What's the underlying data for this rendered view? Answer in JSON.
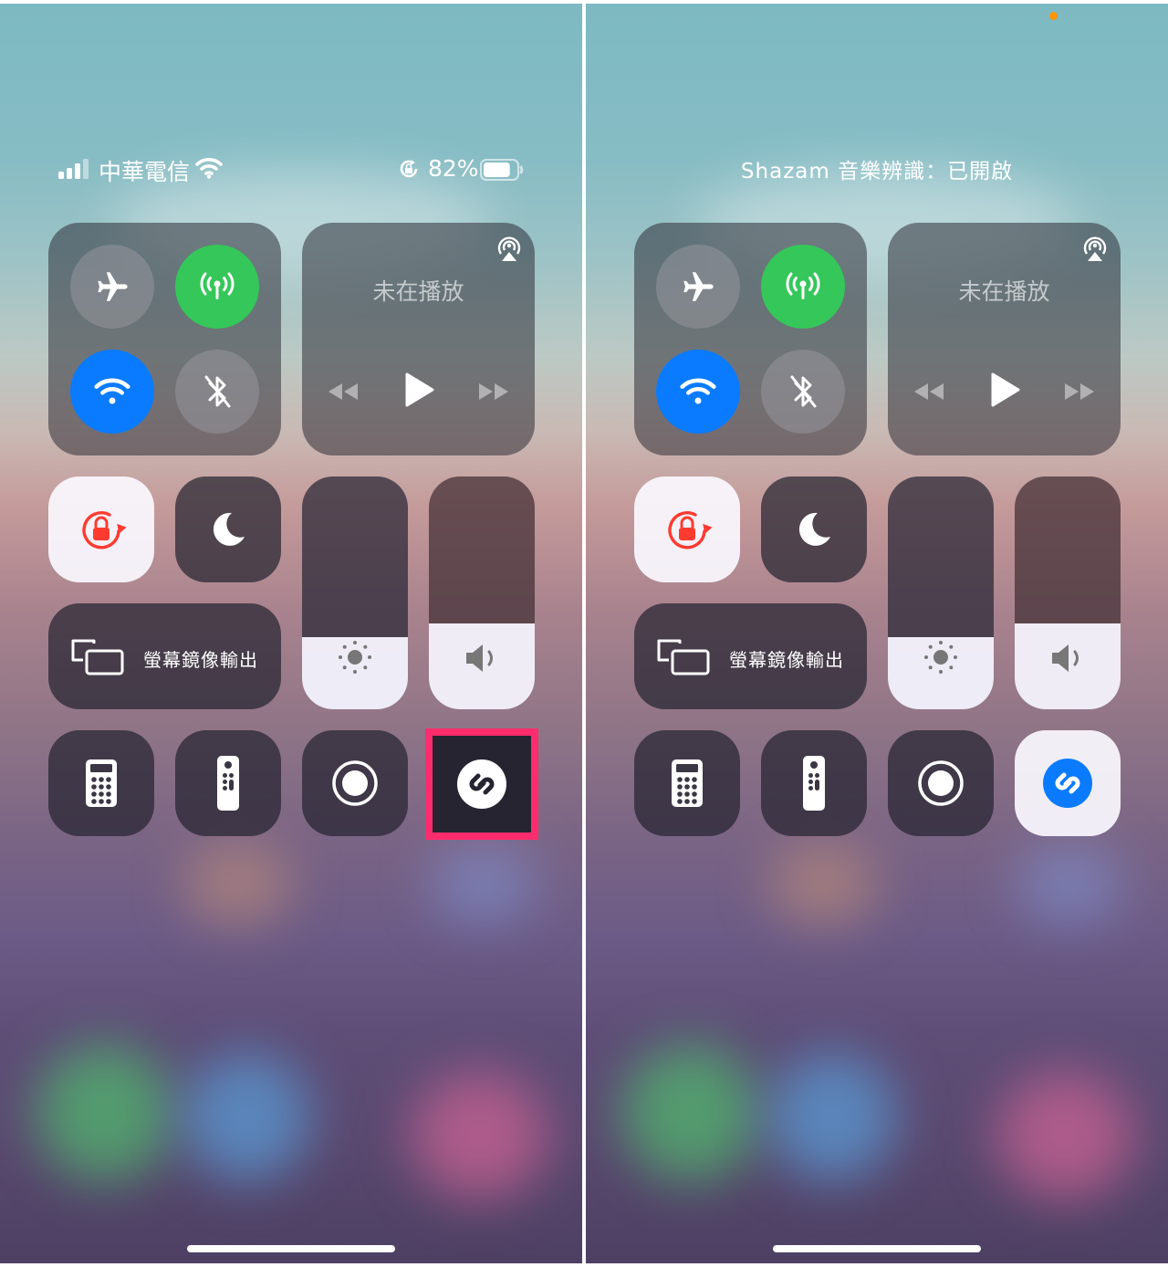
{
  "left_screen": {
    "status_bar": {
      "carrier": "中華電信",
      "battery_percent": "82%",
      "battery_level": 0.82
    },
    "now_playing": {
      "title": "未在播放"
    },
    "screen_mirroring": {
      "label": "螢幕鏡像輸出"
    },
    "brightness_level": 0.31,
    "volume_level": 0.37,
    "shazam_state": "off",
    "highlight_color": "#ff2d6e"
  },
  "right_screen": {
    "banner": "Shazam 音樂辨識：已開啟",
    "now_playing": {
      "title": "未在播放"
    },
    "screen_mirroring": {
      "label": "螢幕鏡像輸出"
    },
    "brightness_level": 0.31,
    "volume_level": 0.37,
    "shazam_state": "on"
  },
  "colors": {
    "cellular_active": "#35c759",
    "wifi_active": "#0a7bff",
    "shazam_on": "#0a7bff",
    "rotation_lock": "#ff3b30",
    "recording_indicator": "#ff9500"
  },
  "icons": [
    "airplane-icon",
    "cellular-icon",
    "wifi-icon",
    "bluetooth-icon",
    "airplay-icon",
    "rewind-icon",
    "play-icon",
    "fast-forward-icon",
    "rotation-lock-icon",
    "moon-icon",
    "screen-mirroring-icon",
    "sun-icon",
    "speaker-icon",
    "calculator-icon",
    "remote-icon",
    "record-icon",
    "shazam-icon"
  ]
}
